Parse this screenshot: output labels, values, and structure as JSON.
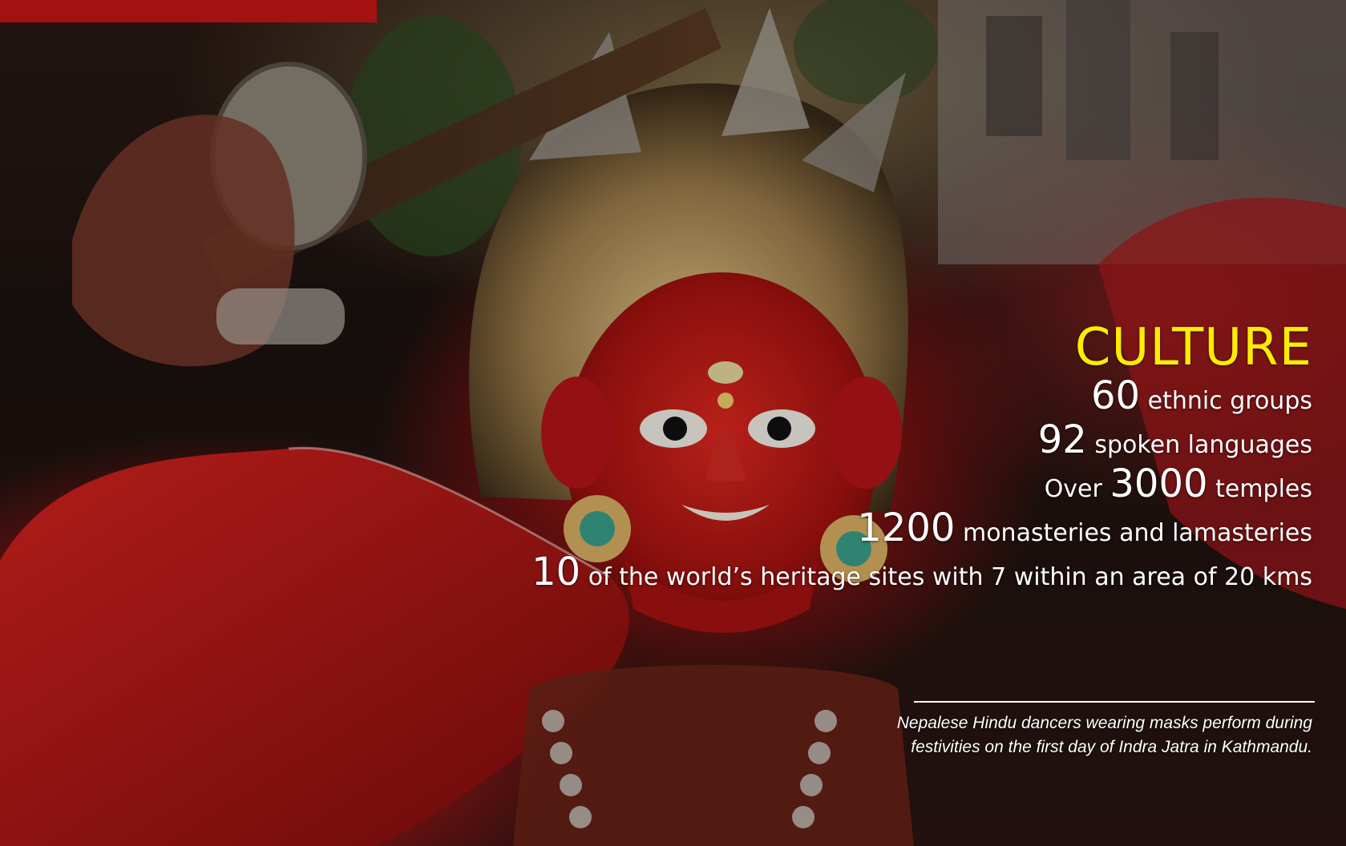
{
  "title": "CULTURE",
  "facts": [
    {
      "pre": "",
      "num": "60",
      "post": " ethnic groups"
    },
    {
      "pre": "",
      "num": "92",
      "post": " spoken languages"
    },
    {
      "pre": "Over ",
      "num": "3000",
      "post": " temples"
    },
    {
      "pre": "",
      "num": "1200",
      "post": " monasteries and lamasteries"
    },
    {
      "pre": "",
      "num": "10",
      "post": " of the world’s heritage sites with 7 within an area of 20 kms"
    }
  ],
  "caption": "Nepalese Hindu dancers wearing masks perform during festivities on the first day of Indra Jatra in Kathmandu.",
  "colors": {
    "title": "#ffec00",
    "text": "#ffffff",
    "mask_red": "#c41a18"
  }
}
